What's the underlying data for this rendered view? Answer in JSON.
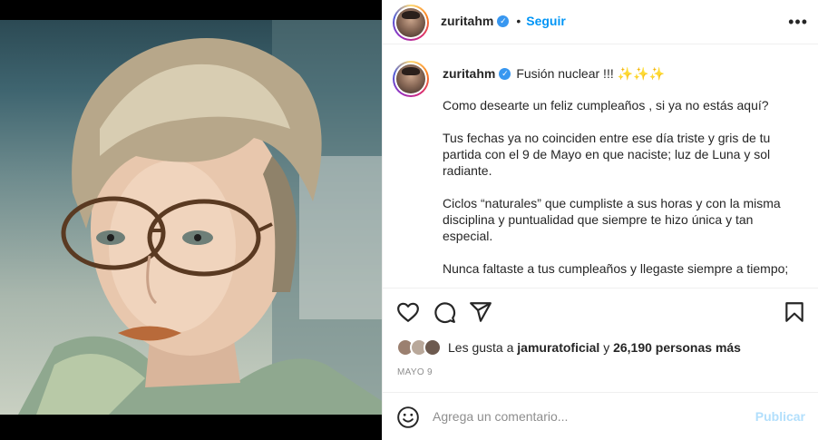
{
  "post": {
    "username": "zuritahm",
    "follow_label": "Seguir",
    "more_label": "•••",
    "separator": "•",
    "verified_mark": "✓"
  },
  "caption": {
    "username": "zuritahm",
    "title": "Fusión nuclear !!! ✨✨✨",
    "paragraphs": [
      "Como desearte un feliz cumpleaños , si ya no estás aquí?",
      "Tus fechas ya no coinciden entre ese día triste y gris de tu partida con el 9 de Mayo en que naciste; luz de Luna y sol radiante.",
      "Ciclos “naturales” que cumpliste a sus horas y con la misma disciplina y puntualidad que siempre te hizo única y tan especial.",
      "Nunca faltaste a tus cumpleaños y llegaste siempre a tiempo;"
    ]
  },
  "likes": {
    "prefix": "Les gusta a",
    "user": "jamuratoficial",
    "connector": "y",
    "count": "26,190 personas más"
  },
  "date": "MAYO 9",
  "comment": {
    "placeholder": "Agrega un comentario...",
    "publish_label": "Publicar"
  },
  "icons": {
    "like": "heart-icon",
    "comment": "comment-icon",
    "share": "send-icon",
    "save": "bookmark-icon",
    "emoji": "emoji-icon",
    "more": "more-icon"
  },
  "colors": {
    "accent": "#0095f6",
    "publish_disabled": "#b2dffc",
    "verified": "#3897f0",
    "muted": "#8e8e8e",
    "text": "#262626"
  }
}
